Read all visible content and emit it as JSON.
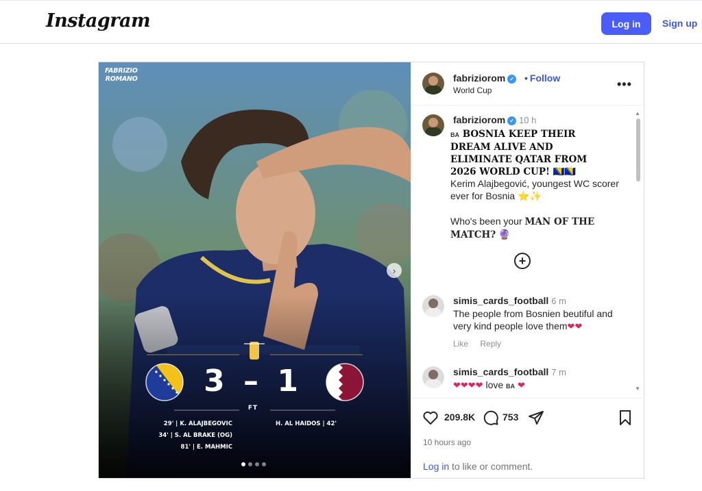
{
  "header": {
    "logo": "Instagram",
    "login_label": "Log in",
    "signup_label": "Sign up"
  },
  "media": {
    "watermark_line1": "FABRIZIO",
    "watermark_line2": "ROMANO",
    "score": "3 – 1",
    "status": "FT",
    "home_scorers": [
      "29' | K. ALAJBEGOVIC",
      "34' | S. AL BRAKE (OG)",
      "81' | E. MAHMIC"
    ],
    "away_scorers": [
      "H. AL HAIDOS | 42'"
    ],
    "slide_count": 4,
    "active_slide": 1,
    "colors": {
      "bosnia_blue": "#1f3c9a",
      "bosnia_yellow": "#f2c21a",
      "qatar_maroon": "#8a1538"
    }
  },
  "post": {
    "author": "fabriziorom",
    "follow_label": "Follow",
    "location": "World Cup",
    "caption": {
      "time": "10 h",
      "flag": "BA",
      "headline": "BOSNIA KEEP THEIR DREAM ALIVE AND ELIMINATE QATAR FROM 2026 WORLD CUP! 🇧🇦🇧🇦",
      "para2": "Kerim Alajbegović, youngest WC scorer ever for Bosnia ⭐✨",
      "para3_prefix": "Who's been your ",
      "para3_bold": "MAN OF THE MATCH?",
      "para3_emoji": "🔮"
    },
    "comments": [
      {
        "user": "simis_cards_football",
        "time": "6 m",
        "text": "The people from Bosnien beutiful and very kind people love them",
        "hearts": "❤❤",
        "like_label": "Like",
        "reply_label": "Reply"
      },
      {
        "user": "simis_cards_football",
        "time": "7 m",
        "hearts_before": "❤❤❤❤",
        "text": " love ",
        "flag": "BA",
        "hearts_after": "❤"
      }
    ],
    "likes": "209.8K",
    "comment_count": "753",
    "posted_ago": "10 hours ago",
    "login_link": "Log in",
    "login_suffix": " to like or comment."
  }
}
